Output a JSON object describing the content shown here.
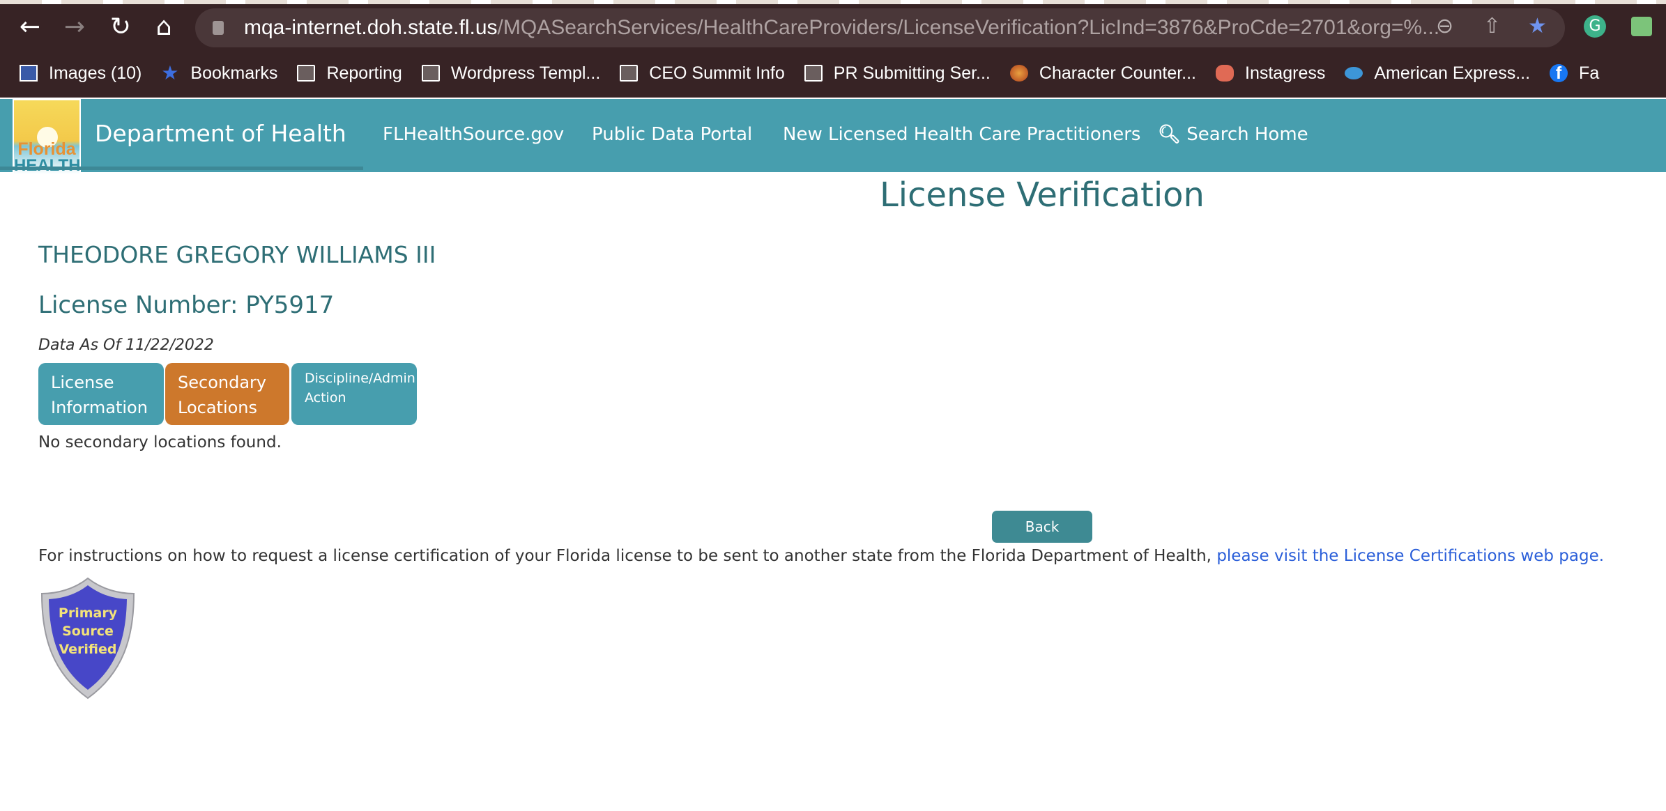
{
  "browser": {
    "url_host": "mqa-internet.doh.state.fl.us",
    "url_path": "/MQASearchServices/HealthCareProviders/LicenseVerification?LicInd=3876&ProCde=2701&org=%...",
    "bookmarks": [
      {
        "label": "Images (10)",
        "icon": "image-icon"
      },
      {
        "label": "Bookmarks",
        "icon": "star-icon"
      },
      {
        "label": "Reporting",
        "icon": "folder-icon"
      },
      {
        "label": "Wordpress Templ...",
        "icon": "folder-icon"
      },
      {
        "label": "CEO Summit Info",
        "icon": "folder-icon"
      },
      {
        "label": "PR Submitting Ser...",
        "icon": "folder-icon"
      },
      {
        "label": "Character Counter...",
        "icon": "orb-icon"
      },
      {
        "label": "Instagress",
        "icon": "instagress-icon"
      },
      {
        "label": "American Express...",
        "icon": "salesforce-icon"
      },
      {
        "label": "Fa",
        "icon": "facebook-icon"
      }
    ]
  },
  "header": {
    "logo_text": [
      "Florida",
      "HEALTH"
    ],
    "dept": "Department of Health",
    "nav": [
      "FLHealthSource.gov",
      "Public Data Portal",
      "New Licensed Health Care Practitioners",
      "Search Home"
    ],
    "color": "#479eae"
  },
  "main": {
    "title": "License Verification",
    "name": "THEODORE GREGORY WILLIAMS III",
    "license_number": "License Number: PY5917",
    "as_of": "Data As Of 11/22/2022",
    "tabs": [
      {
        "label": "License Information",
        "active": false
      },
      {
        "label": "Secondary Locations",
        "active": true
      },
      {
        "label": "Discipline/Admin Action",
        "active": false
      }
    ],
    "message": "No secondary locations found.",
    "back_label": "Back",
    "instructions": "For instructions on how to request a license certification of your Florida license to be sent to another state from the Florida Department of Health,",
    "instructions_link": "please visit the License Certifications web page.",
    "badge": [
      "Primary",
      "Source",
      "Verified"
    ],
    "active_tab_color": "#cd782c"
  }
}
